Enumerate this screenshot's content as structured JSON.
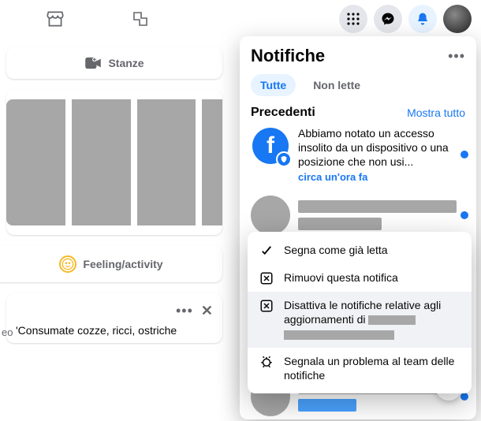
{
  "topbar": {
    "marketplace": "Marketplace",
    "gaming": "Gaming"
  },
  "stanze": {
    "label": "Stanze"
  },
  "feeling": {
    "label": "Feeling/activity"
  },
  "post": {
    "cut_prefix": "eo",
    "text": "'Consumate cozze, ricci, ostriche"
  },
  "panel": {
    "title": "Notifiche",
    "tab_all": "Tutte",
    "tab_unread": "Non lette",
    "section_prev": "Precedenti",
    "show_all": "Mostra tutto",
    "notif1_text": "Abbiamo notato un accesso insolito da un dispositivo o una posizione che non usi...",
    "notif1_time": "circa un'ora fa"
  },
  "ctx": {
    "mark_read": "Segna come già letta",
    "remove": "Rimuovi questa notifica",
    "disable_prefix": "Disattiva le notifiche relative agli aggiornamenti di ",
    "report": "Segnala un problema al team delle notifiche"
  }
}
